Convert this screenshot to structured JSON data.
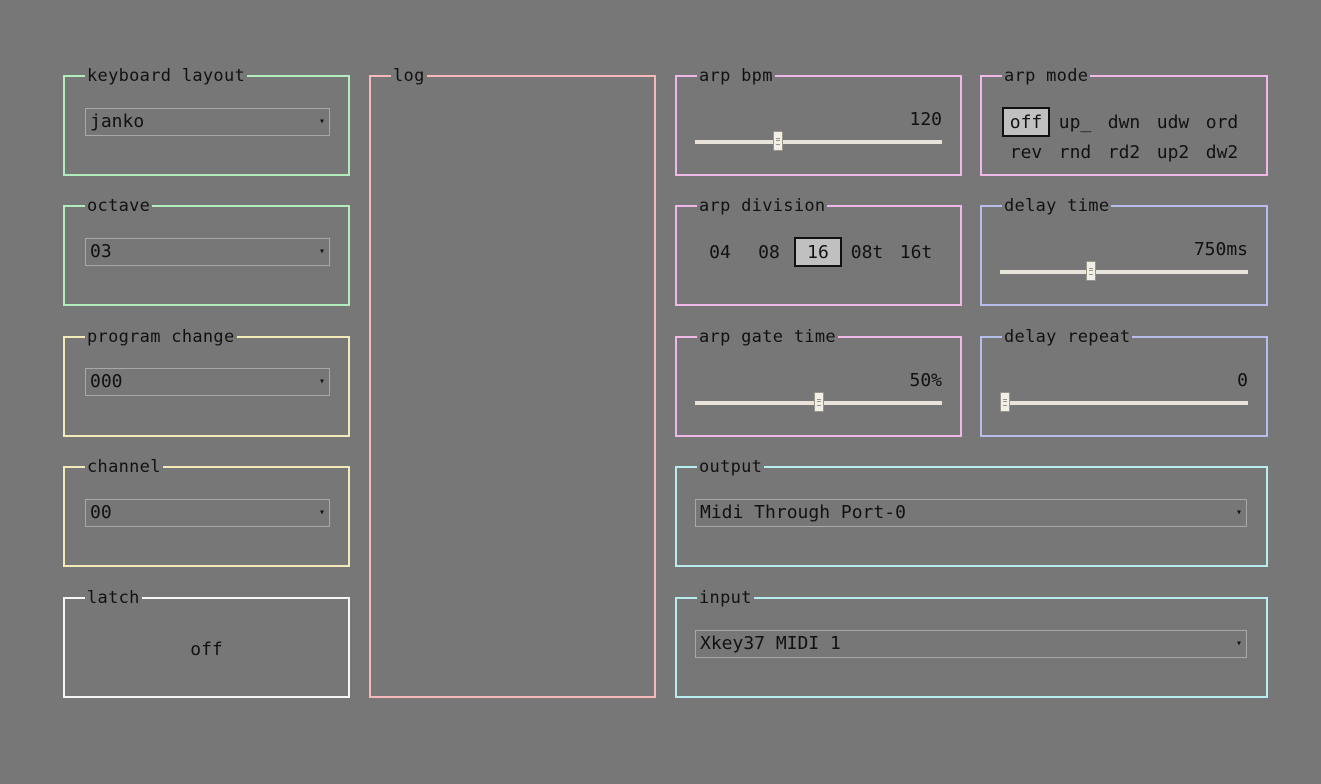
{
  "keyboard_layout": {
    "title": "keyboard layout",
    "value": "janko"
  },
  "octave": {
    "title": "octave",
    "value": "03"
  },
  "program_change": {
    "title": "program change",
    "value": "000"
  },
  "channel": {
    "title": "channel",
    "value": "00"
  },
  "latch": {
    "title": "latch",
    "value": "off"
  },
  "log": {
    "title": "log"
  },
  "arp_bpm": {
    "title": "arp bpm",
    "value": "120",
    "fraction": 0.33
  },
  "arp_mode": {
    "title": "arp mode",
    "options": [
      "off",
      "up_",
      "dwn",
      "udw",
      "ord",
      "rev",
      "rnd",
      "rd2",
      "up2",
      "dw2"
    ],
    "selected": "off"
  },
  "arp_division": {
    "title": "arp division",
    "options": [
      "04",
      "08",
      "16",
      "08t",
      "16t"
    ],
    "selected": "16"
  },
  "delay_time": {
    "title": "delay time",
    "value": "750ms",
    "fraction": 0.36
  },
  "arp_gate_time": {
    "title": "arp gate time",
    "value": "50%",
    "fraction": 0.5
  },
  "delay_repeat": {
    "title": "delay repeat",
    "value": "0",
    "fraction": 0.0
  },
  "output": {
    "title": "output",
    "value": "Midi Through Port-0"
  },
  "input": {
    "title": "input",
    "value": "Xkey37 MIDI 1"
  },
  "icons": {
    "dropdown": "▾"
  }
}
